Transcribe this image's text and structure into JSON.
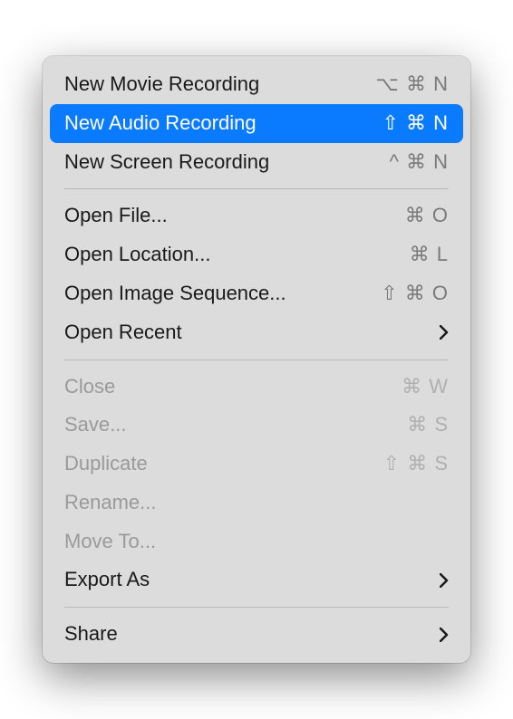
{
  "menu": {
    "items": [
      {
        "id": "new-movie-recording",
        "label": "New Movie Recording",
        "shortcut": "⌥ ⌘ N",
        "enabled": true,
        "highlighted": false,
        "submenu": false
      },
      {
        "id": "new-audio-recording",
        "label": "New Audio Recording",
        "shortcut": "⇧ ⌘ N",
        "enabled": true,
        "highlighted": true,
        "submenu": false
      },
      {
        "id": "new-screen-recording",
        "label": "New Screen Recording",
        "shortcut": "^ ⌘ N",
        "enabled": true,
        "highlighted": false,
        "submenu": false
      },
      {
        "separator": true
      },
      {
        "id": "open-file",
        "label": "Open File...",
        "shortcut": "⌘ O",
        "enabled": true,
        "highlighted": false,
        "submenu": false
      },
      {
        "id": "open-location",
        "label": "Open Location...",
        "shortcut": "⌘ L",
        "enabled": true,
        "highlighted": false,
        "submenu": false
      },
      {
        "id": "open-image-sequence",
        "label": "Open Image Sequence...",
        "shortcut": "⇧ ⌘ O",
        "enabled": true,
        "highlighted": false,
        "submenu": false
      },
      {
        "id": "open-recent",
        "label": "Open Recent",
        "shortcut": "",
        "enabled": true,
        "highlighted": false,
        "submenu": true
      },
      {
        "separator": true
      },
      {
        "id": "close",
        "label": "Close",
        "shortcut": "⌘ W",
        "enabled": false,
        "highlighted": false,
        "submenu": false
      },
      {
        "id": "save",
        "label": "Save...",
        "shortcut": "⌘ S",
        "enabled": false,
        "highlighted": false,
        "submenu": false
      },
      {
        "id": "duplicate",
        "label": "Duplicate",
        "shortcut": "⇧ ⌘ S",
        "enabled": false,
        "highlighted": false,
        "submenu": false
      },
      {
        "id": "rename",
        "label": "Rename...",
        "shortcut": "",
        "enabled": false,
        "highlighted": false,
        "submenu": false
      },
      {
        "id": "move-to",
        "label": "Move To...",
        "shortcut": "",
        "enabled": false,
        "highlighted": false,
        "submenu": false
      },
      {
        "id": "export-as",
        "label": "Export As",
        "shortcut": "",
        "enabled": true,
        "highlighted": false,
        "submenu": true
      },
      {
        "separator": true
      },
      {
        "id": "share",
        "label": "Share",
        "shortcut": "",
        "enabled": true,
        "highlighted": false,
        "submenu": true
      }
    ]
  }
}
